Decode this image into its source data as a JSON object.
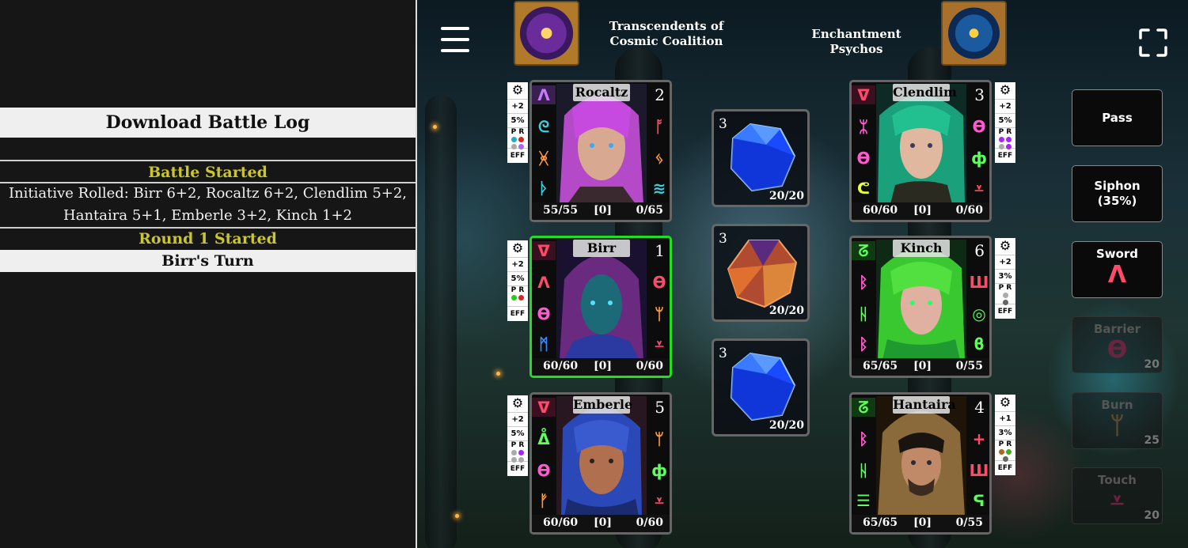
{
  "log": {
    "download_label": "Download Battle Log",
    "entries": [
      {
        "text": "Battle Started"
      },
      {
        "text": "Initiative Rolled: Birr 6+2, Rocaltz 6+2, Clendlim 5+2, Hantaira 5+1, Emberle 3+2, Kinch 1+2"
      },
      {
        "text": "Round 1 Started"
      },
      {
        "text": "Birr's Turn"
      }
    ]
  },
  "teams": {
    "left": {
      "name": "Transcendents of Cosmic Coalition"
    },
    "right": {
      "name": "Enchantment Psychos"
    }
  },
  "icons": {
    "menu": "hamburger-menu-icon",
    "fullscreen": "fullscreen-icon",
    "settings": "gear-icon"
  },
  "units": {
    "rocaltz": {
      "name": "Rocaltz",
      "init": "2",
      "hp": "55/55",
      "shield": "[0]",
      "energy": "0/65",
      "bonus": "+2",
      "pct": "5%",
      "pr": "P R",
      "eff": "EFF",
      "left_runes": [
        "ᐱ",
        "ᘓ",
        "ᚸ",
        "ᚦ"
      ],
      "right_runes": [
        "ᚩ",
        "ᛃ",
        "≋"
      ]
    },
    "birr": {
      "name": "Birr",
      "init": "1",
      "hp": "60/60",
      "shield": "[0]",
      "energy": "0/60",
      "bonus": "+2",
      "pct": "5%",
      "pr": "P R",
      "eff": "EFF",
      "left_runes": [
        "ᐁ",
        "ᐱ",
        "ϴ",
        "ᛗ"
      ],
      "right_runes": [
        "ϴ",
        "ᛘ",
        "⩡"
      ]
    },
    "emberle": {
      "name": "Emberle",
      "init": "5",
      "hp": "60/60",
      "shield": "[0]",
      "energy": "0/60",
      "bonus": "+2",
      "pct": "5%",
      "pr": "P R",
      "eff": "EFF",
      "left_runes": [
        "ᐁ",
        "ᐂ",
        "ϴ",
        "ᚠ"
      ],
      "right_runes": [
        "ᛘ",
        "ф",
        "⩡"
      ]
    },
    "clendlim": {
      "name": "Clendlim",
      "init": "3",
      "hp": "60/60",
      "shield": "[0]",
      "energy": "0/60",
      "bonus": "+2",
      "pct": "5%",
      "pr": "P R",
      "eff": "EFF",
      "left_runes": [
        "ᐁ",
        "ᛯ",
        "ϴ",
        "ᕦ"
      ],
      "right_runes": [
        "ϴ",
        "ф",
        "⩡"
      ]
    },
    "kinch": {
      "name": "Kinch",
      "init": "6",
      "hp": "65/65",
      "shield": "[0]",
      "energy": "0/55",
      "bonus": "+2",
      "pct": "3%",
      "pr": "P R",
      "eff": "EFF",
      "left_runes": [
        "ᘔ",
        "ᛒ",
        "ᚺ",
        "ᛒ"
      ],
      "right_runes": [
        "Ш",
        "◎",
        "ϐ"
      ]
    },
    "hantaira": {
      "name": "Hantaira",
      "init": "4",
      "hp": "65/65",
      "shield": "[0]",
      "energy": "0/55",
      "bonus": "+1",
      "pct": "3%",
      "pr": "P R",
      "eff": "EFF",
      "left_runes": [
        "ᘔ",
        "ᛒ",
        "ᚺ",
        "☰"
      ],
      "right_runes": [
        "+",
        "Ш",
        "ᕋ"
      ]
    }
  },
  "gems": [
    {
      "count": "3",
      "hp": "20/20",
      "color": "#2a5cff"
    },
    {
      "count": "3",
      "hp": "20/20",
      "color": "#c14a2a"
    },
    {
      "count": "3",
      "hp": "20/20",
      "color": "#2a5cff"
    }
  ],
  "actions": {
    "pass": {
      "label": "Pass"
    },
    "siphon": {
      "label": "Siphon",
      "sub": "(35%)"
    },
    "sword": {
      "label": "Sword",
      "symbol": "ᐱ"
    },
    "barrier": {
      "label": "Barrier",
      "symbol": "ϴ",
      "cost": "20"
    },
    "burn": {
      "label": "Burn",
      "symbol": "ᛘ",
      "cost": "25"
    },
    "touch": {
      "label": "Touch",
      "symbol": "⩡",
      "cost": "20"
    }
  },
  "colors": {
    "active_border": "#22dd22",
    "log_heading": "#c9c62e",
    "rune_red": "#ff4a6a",
    "rune_cyan": "#3ad0e0",
    "rune_orange": "#ff9a3a",
    "rune_green": "#5cff5c",
    "rune_pink": "#ff5ad0",
    "rune_purple": "#c87aff"
  }
}
